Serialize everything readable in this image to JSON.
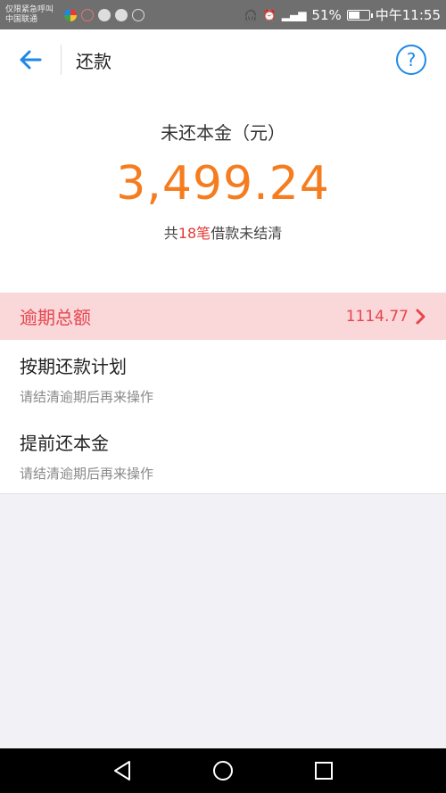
{
  "status_bar": {
    "carrier_line1": "仅限紧急呼叫",
    "carrier_line2": "中国联通",
    "battery": "51%",
    "time": "中午11:55"
  },
  "header": {
    "title": "还款"
  },
  "summary": {
    "principal_label": "未还本金（元）",
    "principal_amount": "3,499.24",
    "loan_prefix": "共",
    "loan_count": "18笔",
    "loan_suffix": "借款未结清"
  },
  "overdue": {
    "label": "逾期总额",
    "value": "1114.77"
  },
  "options": [
    {
      "title": "按期还款计划",
      "subtitle": "请结清逾期后再来操作"
    },
    {
      "title": "提前还本金",
      "subtitle": "请结清逾期后再来操作"
    }
  ],
  "colors": {
    "accent_blue": "#1e88e5",
    "amount_orange": "#f57c1f",
    "overdue_red": "#e5464f",
    "overdue_bg": "#fad7d9"
  },
  "icons": [
    "back-arrow-icon",
    "help-icon",
    "chevron-right-icon",
    "nav-back-icon",
    "nav-home-icon",
    "nav-recents-icon"
  ]
}
